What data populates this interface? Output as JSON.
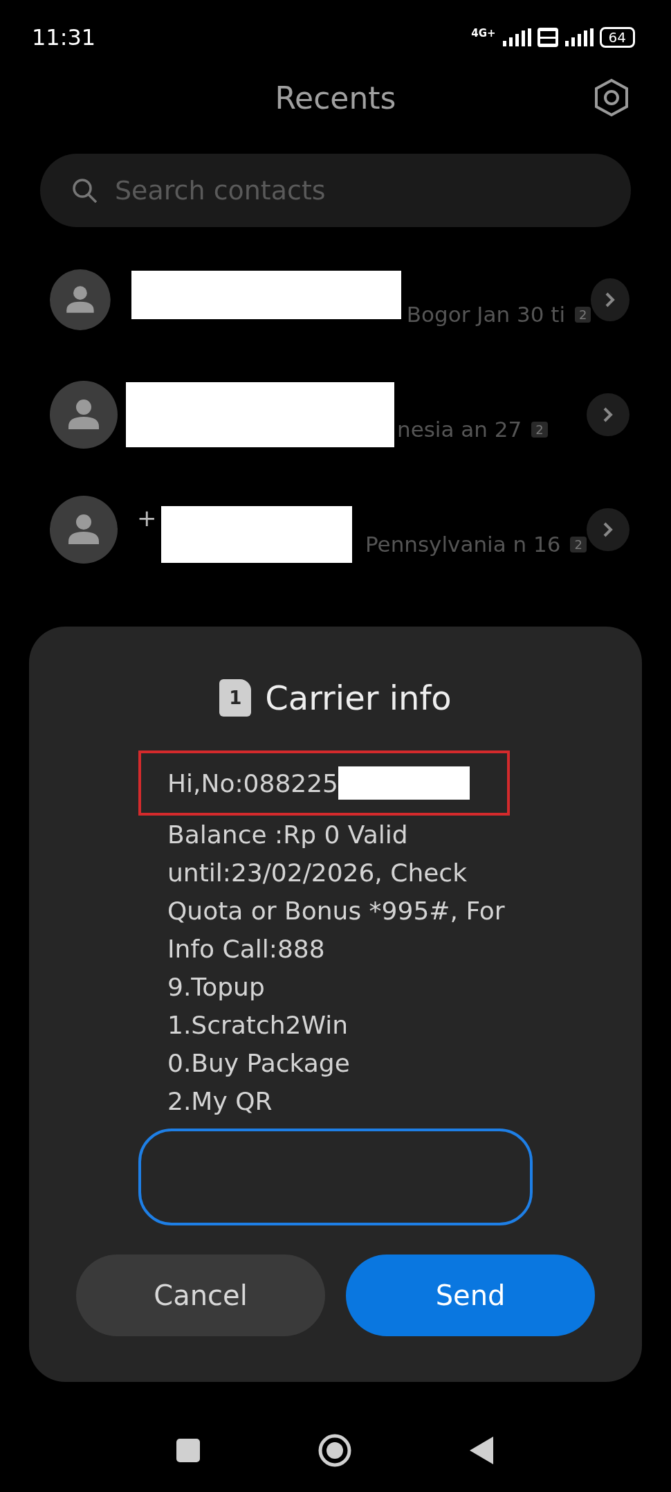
{
  "status_bar": {
    "time": "11:31",
    "network": "4G+",
    "battery": "64"
  },
  "header": {
    "title": "Recents"
  },
  "search": {
    "placeholder": "Search contacts"
  },
  "recents": [
    {
      "detail": "Bogor Jan 30 ti",
      "badge": "2"
    },
    {
      "detail": "nesia an 27",
      "badge": "2"
    },
    {
      "name": "+",
      "detail": "Pennsylvania n 16",
      "badge": "2"
    }
  ],
  "dialog": {
    "sim": "1",
    "title": "Carrier info",
    "first_line": "Hi,No:088225",
    "lines": [
      "Balance :Rp 0 Valid",
      "until:23/02/2026, Check",
      "Quota or Bonus *995#, For",
      "Info Call:888",
      "9.Topup",
      "1.Scratch2Win",
      "0.Buy Package",
      "2.My QR"
    ],
    "buttons": [
      {
        "label": "Cancel",
        "kind": "secondary"
      },
      {
        "label": "Send",
        "kind": "primary"
      }
    ]
  }
}
